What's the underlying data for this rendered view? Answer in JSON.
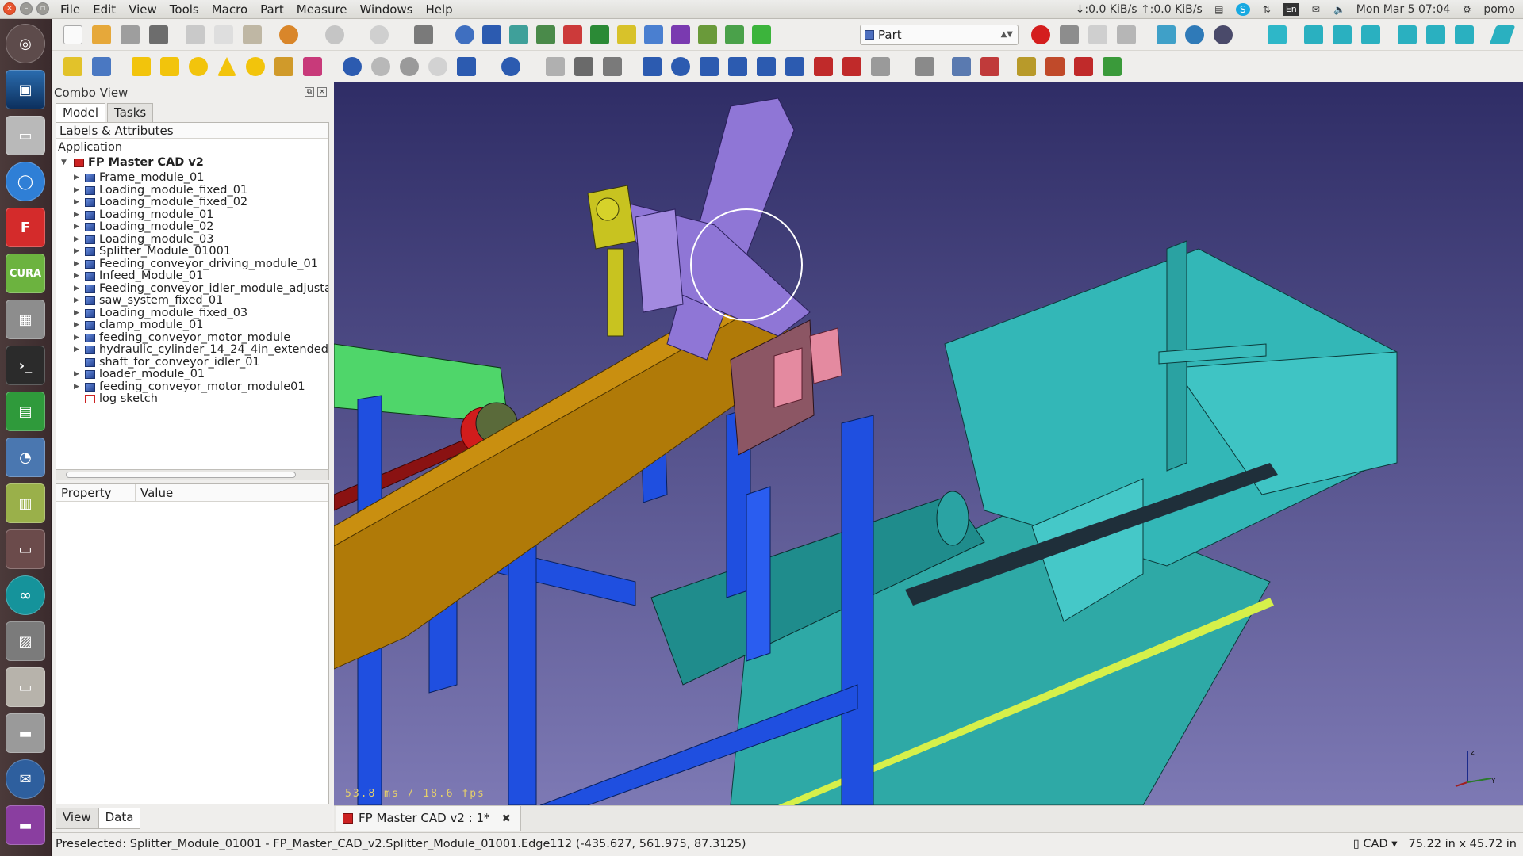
{
  "menubar": {
    "items": [
      "File",
      "Edit",
      "View",
      "Tools",
      "Macro",
      "Part",
      "Measure",
      "Windows",
      "Help"
    ]
  },
  "indicators": {
    "network": "↓:0.0 KiB/s ↑:0.0 KiB/s",
    "keyboard": "En",
    "clock": "Mon Mar  5 07:04",
    "user": "pomo"
  },
  "launcher": {
    "apps": [
      "ubuntu-dash",
      "image-viewer",
      "disk-drive",
      "chromium",
      "freecad",
      "cura",
      "calculator",
      "terminal",
      "spreadsheet",
      "system-monitor",
      "finance-app",
      "workspace-switcher",
      "arduino",
      "file-shredder",
      "file-manager",
      "scanner",
      "thunderbird",
      "presentation"
    ]
  },
  "toolbar": {
    "workbench": "Part"
  },
  "combo": {
    "title": "Combo View",
    "tabs": [
      "Model",
      "Tasks"
    ],
    "tree_header": "Labels & Attributes",
    "application": "Application",
    "document": "FP Master CAD v2",
    "items": [
      "Frame_module_01",
      "Loading_module_fixed_01",
      "Loading_module_fixed_02",
      "Loading_module_01",
      "Loading_module_02",
      "Loading_module_03",
      "Splitter_Module_01001",
      "Feeding_conveyor_driving_module_01",
      "Infeed_Module_01",
      "Feeding_conveyor_idler_module_adjusta",
      "saw_system_fixed_01",
      "Loading_module_fixed_03",
      "clamp_module_01",
      "feeding_conveyor_motor_module",
      "hydraulic_cylinder_14_24_4in_extended_",
      "shaft_for_conveyor_idler_01",
      "loader_module_01",
      "feeding_conveyor_motor_module01",
      "log sketch"
    ],
    "prop_headers": [
      "Property",
      "Value"
    ],
    "bottom_tabs": [
      "View",
      "Data"
    ]
  },
  "viewport": {
    "fps": "53.8 ms / 18.6 fps"
  },
  "doctab": {
    "label": "FP Master CAD v2 : 1*"
  },
  "status": {
    "message": "Preselected: Splitter_Module_01001 - FP_Master_CAD_v2.Splitter_Module_01001.Edge112 (-435.627, 561.975, 87.3125)",
    "nav_style": "CAD",
    "dimensions": "75.22 in x 45.72 in"
  },
  "colors": {
    "frame_blue": "#1f4fe0",
    "beam_orange": "#b07a08",
    "teal": "#3bb4b8",
    "purple": "#8f76d6",
    "yellow": "#c8c320",
    "green": "#4fd66a"
  }
}
